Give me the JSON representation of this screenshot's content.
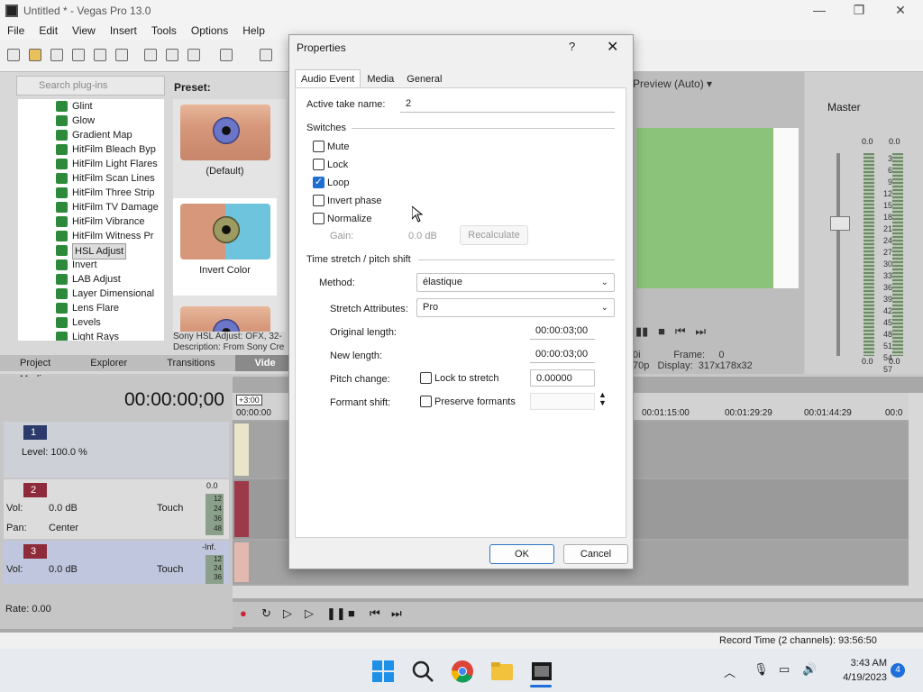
{
  "window": {
    "title": "Untitled * - Vegas Pro 13.0",
    "minimize": "—",
    "restore": "❐",
    "close": "✕"
  },
  "menu": [
    "File",
    "Edit",
    "View",
    "Insert",
    "Tools",
    "Options",
    "Help"
  ],
  "plugins": {
    "search_placeholder": "Search plug-ins",
    "items": [
      "Glint",
      "Glow",
      "Gradient Map",
      "HitFilm Bleach Byp",
      "HitFilm Light Flares",
      "HitFilm Scan Lines",
      "HitFilm Three Strip",
      "HitFilm TV Damage",
      "HitFilm Vibrance",
      "HitFilm Witness Pr",
      "HSL Adjust",
      "Invert",
      "LAB Adjust",
      "Layer Dimensional",
      "Lens Flare",
      "Levels",
      "Light Rays"
    ],
    "selected": "HSL Adjust"
  },
  "presets": {
    "label": "Preset:",
    "items": [
      {
        "caption": "(Default)"
      },
      {
        "caption": "Invert Color"
      }
    ],
    "desc_line1": "Sony HSL Adjust: OFX, 32-",
    "desc_line2": "Description: From Sony Cre"
  },
  "bottom_tabs": [
    "Project Media",
    "Explorer",
    "Transitions",
    "Vide"
  ],
  "preview": {
    "mode": "Preview (Auto)",
    "frame_label": "Frame:",
    "frame_value": "0",
    "display_label": "Display:",
    "display_value": "317x178x32",
    "res_fragment_1": "0i",
    "res_fragment_2": "70p"
  },
  "mixer": {
    "title": "Master",
    "left_peak": "0.0",
    "right_peak": "0.0",
    "scale": [
      "3",
      "6",
      "9",
      "12",
      "15",
      "18",
      "21",
      "24",
      "27",
      "30",
      "33",
      "36",
      "39",
      "42",
      "45",
      "48",
      "51",
      "54",
      "57"
    ],
    "bottom_left": "0.0",
    "bottom_right": "0.0"
  },
  "timeline": {
    "timecode": "00:00:00;00",
    "marker": "+3:00",
    "ruler": [
      "00:00:00",
      "00:01:15:00",
      "00:01:29:29",
      "00:01:44:29",
      "00:0"
    ],
    "track1": {
      "num": "1",
      "level": "Level: 100.0 %"
    },
    "track2": {
      "num": "2",
      "vol_label": "Vol:",
      "vol": "0.0 dB",
      "pan_label": "Pan:",
      "pan": "Center",
      "mode": "Touch",
      "meter": "0.0",
      "scale": [
        "12",
        "24",
        "36",
        "48"
      ]
    },
    "track3": {
      "num": "3",
      "vol_label": "Vol:",
      "vol": "0.0 dB",
      "mode": "Touch",
      "meter": "-Inf.",
      "scale": [
        "12",
        "24",
        "36"
      ]
    },
    "rate": "Rate: 0.00"
  },
  "status": {
    "record_time": "Record Time (2 channels): 93:56:50"
  },
  "dialog": {
    "title": "Properties",
    "help": "?",
    "close": "✕",
    "tabs": [
      "Audio Event",
      "Media",
      "General"
    ],
    "active_take_label": "Active take name:",
    "active_take_value": "2",
    "switches_header": "Switches",
    "switches": [
      {
        "label": "Mute",
        "checked": false
      },
      {
        "label": "Lock",
        "checked": false
      },
      {
        "label": "Loop",
        "checked": true
      },
      {
        "label": "Invert phase",
        "checked": false
      },
      {
        "label": "Normalize",
        "checked": false
      }
    ],
    "gain_label": "Gain:",
    "gain_value": "0.0 dB",
    "recalculate": "Recalculate",
    "stretch_header": "Time stretch / pitch shift",
    "method_label": "Method:",
    "method_value": "élastique",
    "stretch_attr_label": "Stretch Attributes:",
    "stretch_attr_value": "Pro",
    "original_length_label": "Original length:",
    "original_length_value": "00:00:03;00",
    "new_length_label": "New length:",
    "new_length_value": "00:00:03;00",
    "pitch_label": "Pitch change:",
    "lock_stretch_label": "Lock to stretch",
    "pitch_value": "0.00000",
    "formant_label": "Formant shift:",
    "preserve_formants_label": "Preserve formants",
    "formant_value": "",
    "ok": "OK",
    "cancel": "Cancel"
  },
  "taskbar": {
    "time": "3:43 AM",
    "date": "4/19/2023",
    "notifications": "4"
  },
  "colors": {
    "accent": "#1f6fd0",
    "track2": "#8e2b3b",
    "track3": "#8e2b3b",
    "track1": "#2a3a6a",
    "preview_green": "#8cc37a"
  }
}
